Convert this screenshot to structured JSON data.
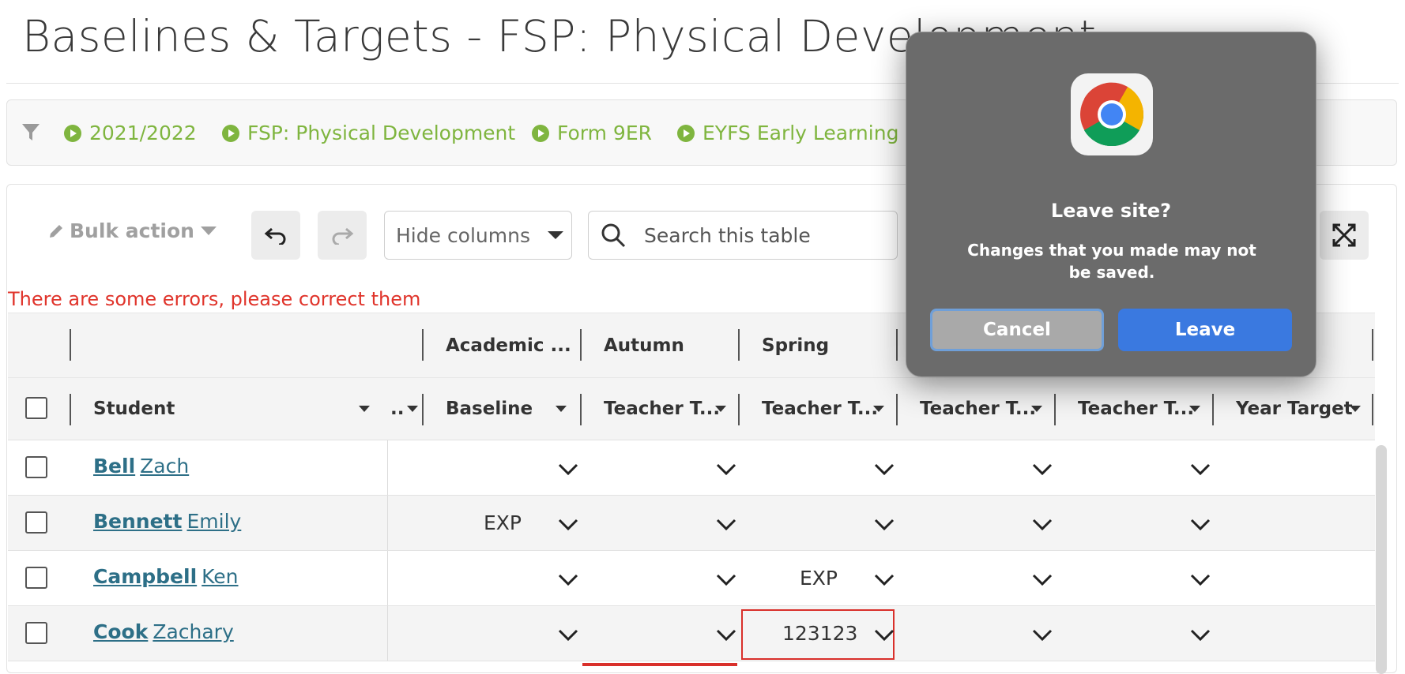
{
  "page": {
    "title": "Baselines & Targets - FSP: Physical Development"
  },
  "filters": [
    "2021/2022",
    "FSP: Physical Development",
    "Form 9ER",
    "EYFS Early Learning G"
  ],
  "toolbar": {
    "bulk_action": "Bulk action",
    "hide_columns": "Hide columns",
    "search_placeholder": "Search this table"
  },
  "error_message": "There are some errors, please correct them",
  "table": {
    "group_headers": [
      "Academic ...",
      "Autumn",
      "Spring"
    ],
    "column_headers": [
      "Student",
      "..",
      "Baseline",
      "Teacher T...",
      "Teacher T...",
      "Teacher T...",
      "Teacher T...",
      "Year Target"
    ],
    "rows": [
      {
        "last": "Bell",
        "first": "Zach",
        "baseline": "",
        "spring": ""
      },
      {
        "last": "Bennett",
        "first": "Emily",
        "baseline": "EXP",
        "spring": ""
      },
      {
        "last": "Campbell",
        "first": "Ken",
        "baseline": "",
        "spring": "EXP"
      },
      {
        "last": "Cook",
        "first": "Zachary",
        "baseline": "",
        "spring": "123123"
      }
    ]
  },
  "dialog": {
    "title": "Leave site?",
    "message": "Changes that you made may not be saved.",
    "cancel": "Cancel",
    "leave": "Leave"
  },
  "colors": {
    "accent_green": "#7fb53f",
    "link_teal": "#2d6f87",
    "error_red": "#d9302b",
    "leave_blue": "#3a79e0"
  }
}
